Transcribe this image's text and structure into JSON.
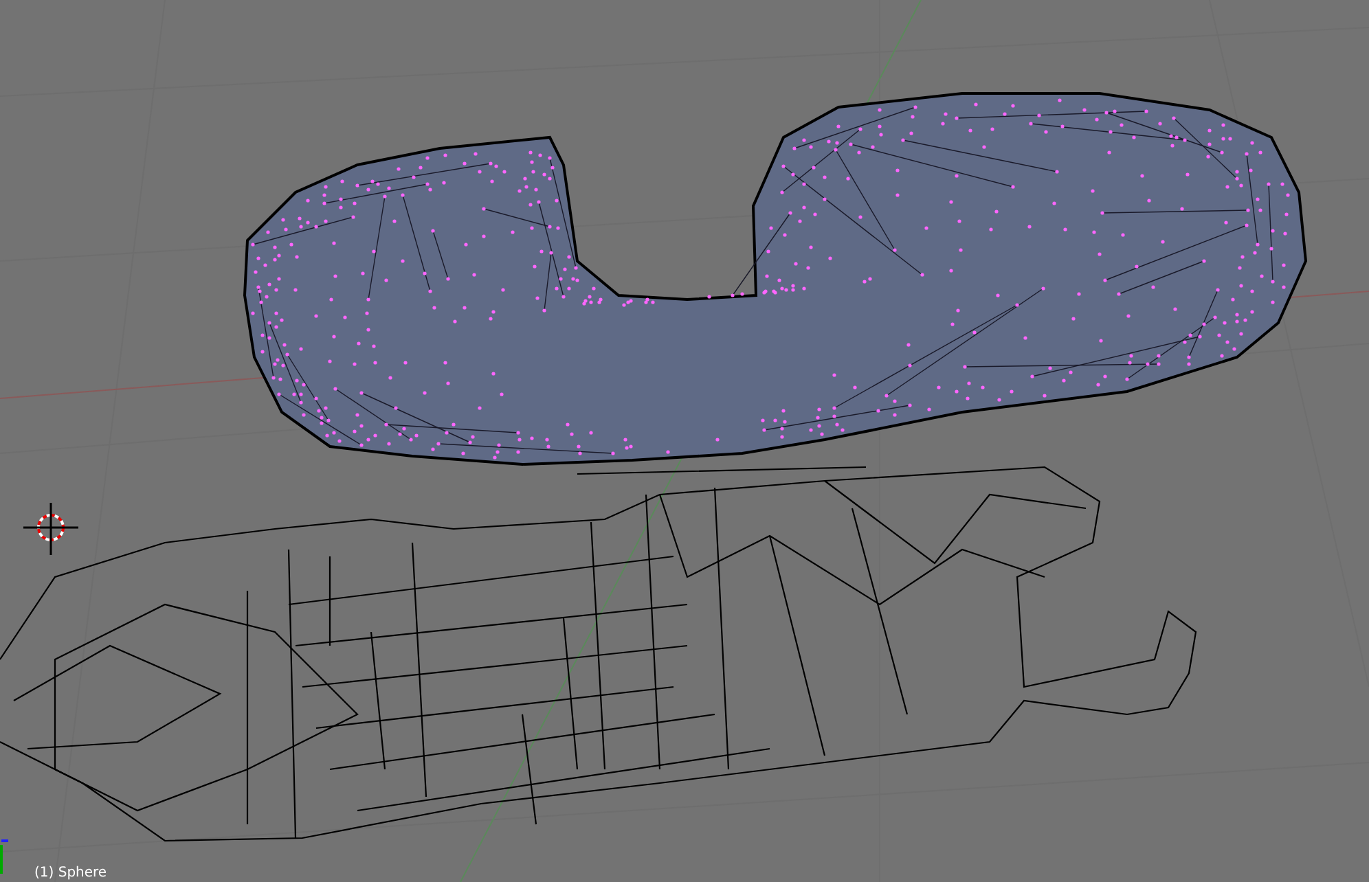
{
  "viewport": {
    "object_label": "(1) Sphere"
  }
}
